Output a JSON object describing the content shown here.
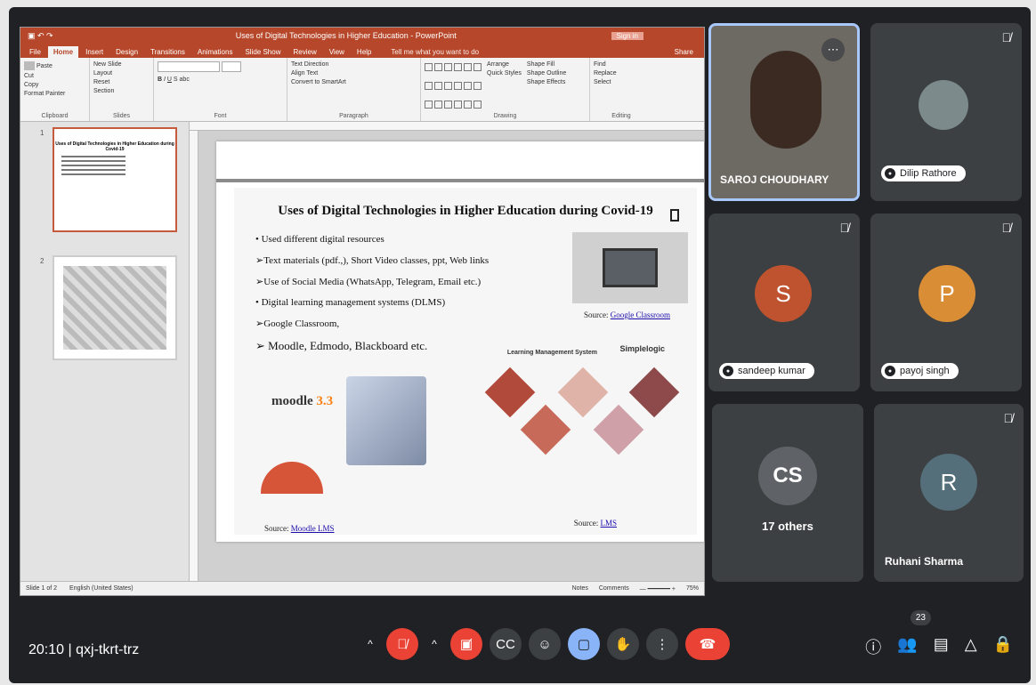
{
  "ppt": {
    "doc_title": "Uses of Digital Technologies in Higher Education - PowerPoint",
    "sign_in": "Sign in",
    "menu": [
      "File",
      "Home",
      "Insert",
      "Design",
      "Transitions",
      "Animations",
      "Slide Show",
      "Review",
      "View",
      "Help"
    ],
    "tell_me": "Tell me what you want to do",
    "share": "Share",
    "ribbon": {
      "clipboard": {
        "paste": "Paste",
        "cut": "Cut",
        "copy": "Copy",
        "format_painter": "Format Painter",
        "label": "Clipboard"
      },
      "slides": {
        "new_slide": "New Slide",
        "layout": "Layout",
        "reset": "Reset",
        "section": "Section",
        "label": "Slides"
      },
      "font_label": "Font",
      "paragraph": {
        "text_direction": "Text Direction",
        "align_text": "Align Text",
        "convert_smartart": "Convert to SmartArt",
        "label": "Paragraph"
      },
      "drawing": {
        "arrange": "Arrange",
        "quick_styles": "Quick Styles",
        "shape_fill": "Shape Fill",
        "shape_outline": "Shape Outline",
        "shape_effects": "Shape Effects",
        "label": "Drawing"
      },
      "editing": {
        "find": "Find",
        "replace": "Replace",
        "select": "Select",
        "label": "Editing"
      }
    },
    "thumbs": [
      {
        "num": "1",
        "mini_title": "Uses of Digital Technologies in Higher Education during Covid-19"
      },
      {
        "num": "2"
      }
    ],
    "slide": {
      "title": "Uses of Digital Technologies in Higher Education during Covid-19",
      "bullets": [
        "• Used different digital resources",
        "➢Text materials (pdf.,), Short Video classes, ppt, Web links",
        "➢Use of Social Media (WhatsApp, Telegram, Email etc.)",
        "• Digital learning management systems (DLMS)",
        "➢Google Classroom,",
        "➢ Moodle, Edmodo, Blackboard etc."
      ],
      "gc_source_prefix": "Source:",
      "gc_source_link": "Google Classroom",
      "lms_brand": "Simplelogic",
      "lms_title": "Learning Management System",
      "moodle_logo_prefix": "moodle",
      "moodle_logo_suffix": "3.3",
      "moodle_source_prefix": "Source:",
      "moodle_source_link": "Moodle LMS",
      "lms_source_prefix": "Source:",
      "lms_source_link": "LMS"
    },
    "status": {
      "slide_of": "Slide 1 of 2",
      "language": "English (United States)",
      "notes": "Notes",
      "comments": "Comments",
      "zoom": "75%"
    }
  },
  "participants": [
    {
      "name": "SAROJ CHOUDHARY",
      "type": "video"
    },
    {
      "name": "Dilip Rathore",
      "type": "photo"
    },
    {
      "name": "sandeep kumar",
      "initial": "S",
      "color": "#c0532f"
    },
    {
      "name": "payoj singh",
      "initial": "P",
      "color": "#d98e36"
    },
    {
      "label": "17 others",
      "initials": "CS"
    },
    {
      "name": "Ruhani Sharma",
      "initial": "R",
      "color": "#546e7a"
    }
  ],
  "meeting": {
    "time": "20:10",
    "separator": "|",
    "code": "qxj-tkrt-trz",
    "participant_count": "23"
  },
  "colors": {
    "ppt_accent": "#b7472a",
    "meet_bg": "#202124",
    "tile_bg": "#3c4043",
    "end_call": "#ea4335",
    "active_speaker_border": "#a8c7fa"
  },
  "icons": {
    "mic": "mic-off-icon",
    "camera": "camera-off-icon",
    "captions": "captions-icon",
    "emoji": "emoji-icon",
    "present": "present-icon",
    "hand": "raise-hand-icon",
    "more": "more-vert-icon",
    "end": "end-call-icon",
    "info": "info-icon",
    "people": "people-icon",
    "chat": "chat-icon",
    "activities": "activities-icon",
    "lock": "host-controls-icon"
  }
}
